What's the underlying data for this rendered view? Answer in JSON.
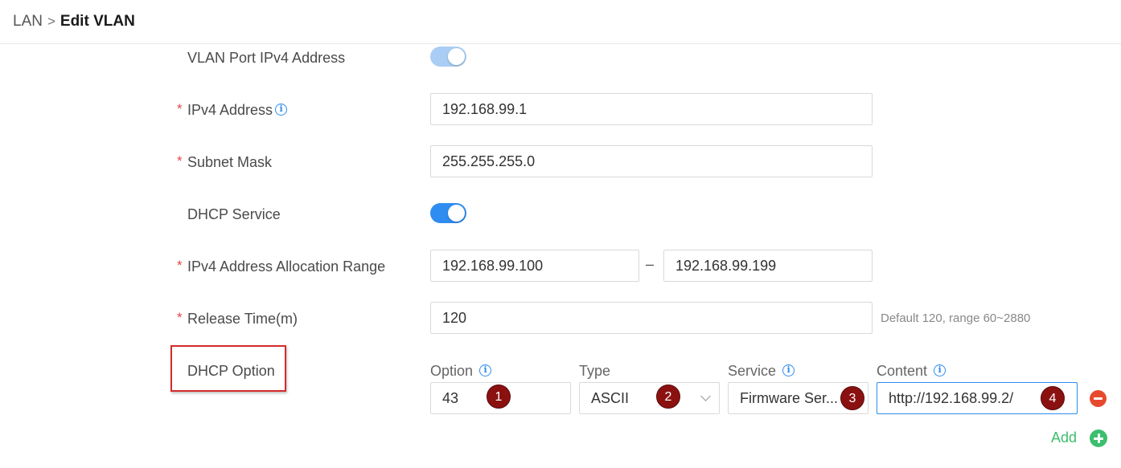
{
  "breadcrumb": {
    "root": "LAN",
    "separator": ">",
    "current": "Edit VLAN"
  },
  "form": {
    "vlan_port_ipv4": {
      "label": "VLAN Port IPv4 Address",
      "enabled": true,
      "disabled": true
    },
    "ipv4_address": {
      "label": "IPv4 Address",
      "required": "*",
      "value": "192.168.99.1",
      "info_icon": "info-icon"
    },
    "subnet_mask": {
      "label": "Subnet Mask",
      "required": "*",
      "value": "255.255.255.0"
    },
    "dhcp_service": {
      "label": "DHCP Service",
      "enabled": true
    },
    "allocation_range": {
      "label": "IPv4 Address Allocation Range",
      "required": "*",
      "start": "192.168.99.100",
      "separator": "–",
      "end": "192.168.99.199"
    },
    "release_time": {
      "label": "Release Time(m)",
      "required": "*",
      "value": "120",
      "hint": "Default 120, range 60~2880"
    },
    "dhcp_option": {
      "label": "DHCP Option",
      "columns": {
        "option": "Option",
        "type": "Type",
        "service": "Service",
        "content": "Content"
      },
      "row": {
        "option": "43",
        "type": "ASCII",
        "service": "Firmware Ser...",
        "content": "http://192.168.99.2/"
      },
      "markers": [
        "1",
        "2",
        "3",
        "4"
      ],
      "add_label": "Add"
    }
  },
  "colors": {
    "accent": "#2f8cf0",
    "required": "#e64545",
    "add": "#3cbf6e",
    "remove": "#e64a2e",
    "highlight": "#d62b2b",
    "marker": "#8b1111"
  }
}
